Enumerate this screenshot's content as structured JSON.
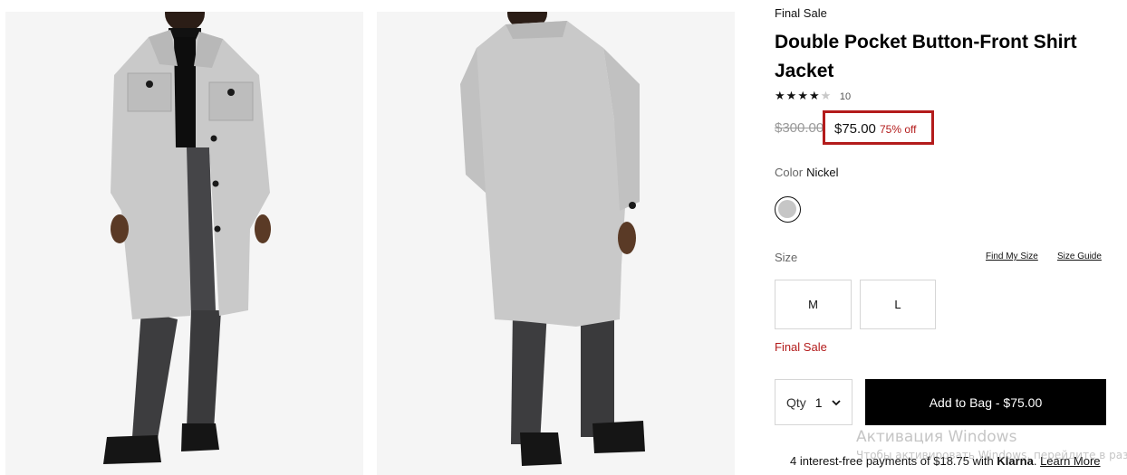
{
  "product": {
    "badge": "Final Sale",
    "title": "Double Pocket Button-Front Shirt Jacket",
    "rating": {
      "stars_filled": 4,
      "stars_total": 5,
      "review_count": "10"
    },
    "price": {
      "original": "$300.00",
      "current": "$75.00",
      "discount": "75% off"
    },
    "color": {
      "label": "Color",
      "value": "Nickel",
      "swatch_hex": "#c6c6c6"
    },
    "size": {
      "label": "Size",
      "find_my_size": "Find My Size",
      "size_guide": "Size Guide",
      "options": [
        "M",
        "L"
      ]
    },
    "final_sale_note": "Final Sale",
    "quantity": {
      "label": "Qty",
      "value": "1"
    },
    "add_to_bag": "Add to Bag  -  $75.00",
    "klarna": {
      "prefix": "4 interest-free payments of $18.75 with ",
      "brand": "Klarna",
      "suffix": ". ",
      "link": "Learn More"
    }
  },
  "images": [
    {
      "alt": "front view",
      "icon": "coat-front-photo"
    },
    {
      "alt": "back view",
      "icon": "coat-back-photo"
    }
  ],
  "os_watermark": {
    "title": "Активация Windows",
    "subtitle": "Чтобы активировать Windows, перейдите в раздел \"Параметры\"."
  },
  "colors": {
    "accent_red": "#b31b1b",
    "button_black": "#000000"
  }
}
